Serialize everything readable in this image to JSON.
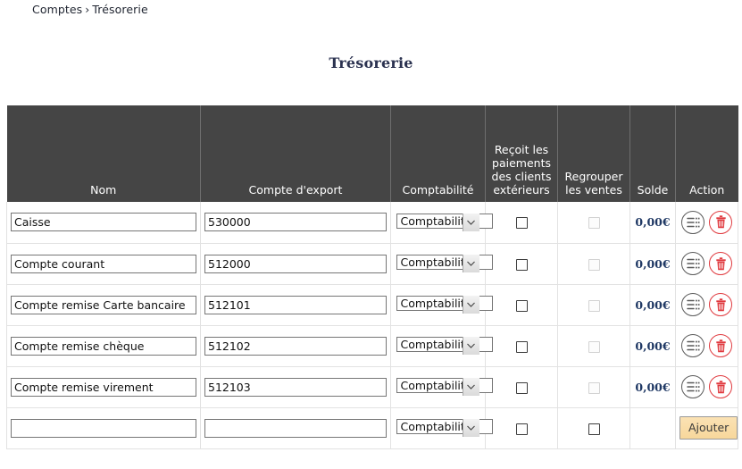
{
  "breadcrumb": {
    "items": [
      "Comptes",
      "Trésorerie"
    ],
    "separator": "›"
  },
  "page_title": "Trésorerie",
  "colors": {
    "header_bg": "#454545",
    "header_text": "#ffffff",
    "title_text": "#2b3250",
    "solde_text": "#1f3864",
    "delete_icon": "#e0393e",
    "detail_icon": "#5a5a5a",
    "add_button_bg": "#f9dda6"
  },
  "table": {
    "columns": [
      {
        "key": "nom",
        "label": "Nom"
      },
      {
        "key": "export",
        "label": "Compte d'export"
      },
      {
        "key": "compta",
        "label": "Comptabilité"
      },
      {
        "key": "recoit",
        "label": "Reçoit les paiements des clients extérieurs"
      },
      {
        "key": "regrouper",
        "label": "Regrouper les ventes"
      },
      {
        "key": "solde",
        "label": "Solde"
      },
      {
        "key": "action",
        "label": "Action"
      }
    ],
    "rows": [
      {
        "nom": "Caisse",
        "export": "530000",
        "compta": "Comptabilité",
        "recoit_checked": false,
        "recoit_disabled": false,
        "regrouper_checked": false,
        "regrouper_disabled": true,
        "solde": "0,00€",
        "actions": [
          "detail-icon",
          "trash-icon"
        ]
      },
      {
        "nom": "Compte courant",
        "export": "512000",
        "compta": "Comptabilité",
        "recoit_checked": false,
        "recoit_disabled": false,
        "regrouper_checked": false,
        "regrouper_disabled": true,
        "solde": "0,00€",
        "actions": [
          "detail-icon",
          "trash-icon"
        ]
      },
      {
        "nom": "Compte remise Carte bancaire",
        "export": "512101",
        "compta": "Comptabilité",
        "recoit_checked": false,
        "recoit_disabled": false,
        "regrouper_checked": false,
        "regrouper_disabled": true,
        "solde": "0,00€",
        "actions": [
          "detail-icon",
          "trash-icon"
        ]
      },
      {
        "nom": "Compte remise chèque",
        "export": "512102",
        "compta": "Comptabilité",
        "recoit_checked": false,
        "recoit_disabled": false,
        "regrouper_checked": false,
        "regrouper_disabled": true,
        "solde": "0,00€",
        "actions": [
          "detail-icon",
          "trash-icon"
        ]
      },
      {
        "nom": "Compte remise virement",
        "export": "512103",
        "compta": "Comptabilité",
        "recoit_checked": false,
        "recoit_disabled": false,
        "regrouper_checked": false,
        "regrouper_disabled": true,
        "solde": "0,00€",
        "actions": [
          "detail-icon",
          "trash-icon"
        ]
      }
    ],
    "new_row": {
      "nom_value": "",
      "nom_placeholder": "",
      "export_value": "",
      "export_placeholder": "",
      "compta": "Comptabilité",
      "recoit_checked": false,
      "recoit_disabled": false,
      "regrouper_checked": false,
      "regrouper_disabled": false,
      "add_label": "Ajouter"
    }
  }
}
